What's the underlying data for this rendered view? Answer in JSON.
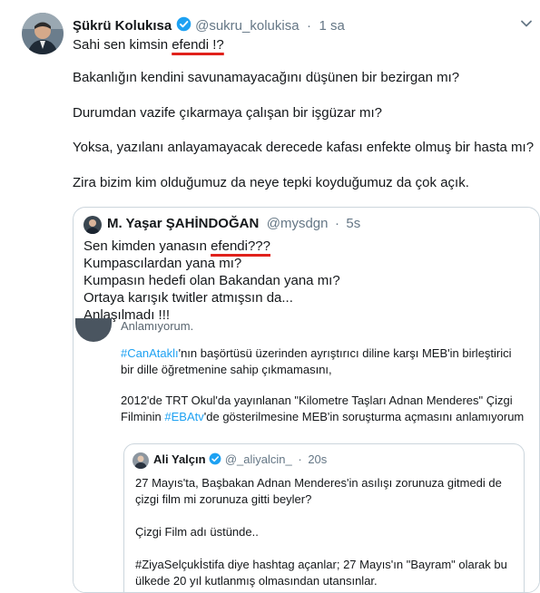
{
  "tweet": {
    "author_name": "Şükrü Kolukısa",
    "handle": "@sukru_kolukisa",
    "separator": "·",
    "time": "1 sa",
    "line1_before": "Sahi sen kimsin ",
    "line1_highlight": "efendi !?",
    "paragraphs": [
      "Bakanlığın kendini savunamayacağını düşünen bir bezirgan mı?",
      "Durumdan vazife çıkarmaya çalışan bir işgüzar mı?",
      "Yoksa, yazılanı anlayamayacak derecede kafası enfekte olmuş bir hasta mı?",
      "Zira bizim kim olduğumuz da neye tepki koyduğumuz da çok açık."
    ]
  },
  "quoted": {
    "author_name": "M. Yaşar ŞAHİNDOĞAN",
    "handle": "@mysdgn",
    "separator": "·",
    "time": "5s",
    "line1_before": "Sen kimden yanasın ",
    "line1_highlight": "efendi???",
    "lines": [
      "Kumpascılardan yana mı?",
      "Kumpasın hedefi olan Bakandan yana mı?",
      "Ortaya karışık twitler atmışsın da...",
      "Anlaşılmadı !!!"
    ]
  },
  "overlapped": {
    "cut_text": "Anlamıyorum.",
    "p1_hashtag": "#CanAtaklı",
    "p1_rest": "'nın başörtüsü üzerinden ayrıştırıcı diline karşı MEB'in birleştirici",
    "p1_line2": "bir dille öğretmenine sahip çıkmamasını,",
    "p2_line1": "2012'de TRT Okul'da yayınlanan \"Kilometre Taşları Adnan Menderes\" Çizgi",
    "p2_before": "Filminin ",
    "p2_hashtag": "#EBAtv",
    "p2_after": "'de gösterilmesine MEB'in soruşturma açmasını anlamıyorum"
  },
  "inner_quote": {
    "author_name": "Ali Yalçın",
    "handle": "@_aliyalcin_",
    "separator": "·",
    "time": "20s",
    "lines": [
      "27 Mayıs'ta, Başbakan Adnan Menderes'in asılışı zorunuza gitmedi de",
      "çizgi film mi zorunuza gitti beyler?",
      "",
      "Çizgi Film adı üstünde..",
      "",
      "#ZiyaSelçukİstifa diye hashtag açanlar; 27 Mayıs'ın \"Bayram\" olarak bu",
      "ülkede 20 yıl kutlanmış olmasından utansınlar."
    ]
  },
  "icons": {
    "verified": "verified-badge-icon",
    "caret": "chevron-down-icon"
  },
  "colors": {
    "verified": "#1da1f2",
    "highlight_underline": "#e0211b",
    "hashtag": "#1da1f2"
  }
}
